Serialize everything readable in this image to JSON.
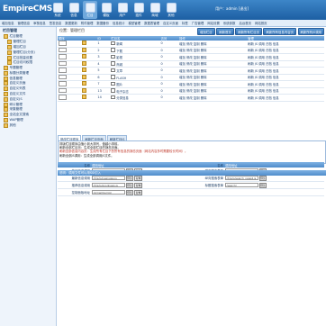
{
  "app": {
    "logo": "EmpireCMS"
  },
  "header": {
    "tabs": [
      {
        "label": "系统",
        "icon": "system-icon",
        "active": false
      },
      {
        "label": "信息",
        "icon": "info-icon",
        "active": false
      },
      {
        "label": "栏目",
        "icon": "column-icon",
        "active": true
      },
      {
        "label": "模板",
        "icon": "template-icon",
        "active": false
      },
      {
        "label": "用户",
        "icon": "user-icon",
        "active": false
      },
      {
        "label": "插件",
        "icon": "plugin-icon",
        "active": false
      },
      {
        "label": "商城",
        "icon": "shop-icon",
        "active": false
      },
      {
        "label": "其他",
        "icon": "other-icon",
        "active": false
      }
    ],
    "user_text": "用户：admin [退出]"
  },
  "menubar": [
    "增加信息",
    "管理信息",
    "审核信息",
    "签发信息",
    "数据更新",
    "附件管理",
    "数据备份",
    "信息统计",
    "模型管理",
    "数据表管理",
    "自定义页面",
    "标签",
    "广告管理",
    "网站设置",
    "系统参数",
    "后台首页",
    "网站首页"
  ],
  "sidebar": {
    "title": "栏目管理",
    "items": [
      {
        "label": "栏目管理",
        "sub": false
      },
      {
        "label": "管理栏目",
        "sub": true
      },
      {
        "label": "增加栏目",
        "sub": true
      },
      {
        "label": "管理栏目(分页)",
        "sub": true
      },
      {
        "label": "栏目批量设置",
        "sub": true
      },
      {
        "label": "栏目访问权限",
        "sub": true
      },
      {
        "label": "专题管理",
        "sub": false
      },
      {
        "label": "标题分类管理",
        "sub": false
      },
      {
        "label": "信息管理",
        "sub": false
      },
      {
        "label": "自定义页面",
        "sub": false
      },
      {
        "label": "自定义列表",
        "sub": false
      },
      {
        "label": "自定义文件",
        "sub": false
      },
      {
        "label": "自定义JS",
        "sub": false
      },
      {
        "label": "碎片管理",
        "sub": false
      },
      {
        "label": "采集管理",
        "sub": false
      },
      {
        "label": "全站全文搜索",
        "sub": false
      },
      {
        "label": "WAP管理",
        "sub": false
      },
      {
        "label": "其他",
        "sub": false
      }
    ]
  },
  "main": {
    "breadcrumb": "位置：管理栏目",
    "top_buttons": [
      "增加栏目",
      "刷新首页",
      "刷新所有栏目页",
      "刷新所有信息内容页",
      "刷新所有JS调用"
    ],
    "table": {
      "headers": [
        "顺序",
        "",
        "ID",
        "栏目名",
        "",
        "访问",
        "操作",
        "管理"
      ],
      "rows": [
        {
          "order": "1",
          "id": "1",
          "name": "新闻",
          "visits": "0",
          "ops": "增加 修改 复制 删除",
          "manage": "刷新 JS 调用 归档 信息"
        },
        {
          "order": "2",
          "id": "2",
          "name": "下载",
          "visits": "0",
          "ops": "增加 修改 复制 删除",
          "manage": "刷新 JS 调用 归档 信息"
        },
        {
          "order": "3",
          "id": "3",
          "name": "影视",
          "visits": "0",
          "ops": "增加 修改 复制 删除",
          "manage": "刷新 JS 调用 归档 信息"
        },
        {
          "order": "4",
          "id": "4",
          "name": "商城",
          "visits": "0",
          "ops": "增加 修改 复制 删除",
          "manage": "刷新 JS 调用 归档 信息"
        },
        {
          "order": "5",
          "id": "5",
          "name": "文章",
          "visits": "0",
          "ops": "增加 修改 复制 删除",
          "manage": "刷新 JS 调用 归档 信息"
        },
        {
          "order": "6",
          "id": "6",
          "name": "FLASH",
          "visits": "0",
          "ops": "增加 修改 复制 删除",
          "manage": "刷新 JS 调用 归档 信息"
        },
        {
          "order": "7",
          "id": "7",
          "name": "图片",
          "visits": "0",
          "ops": "增加 修改 复制 删除",
          "manage": "刷新 JS 调用 归档 信息"
        },
        {
          "order": "13",
          "id": "13",
          "name": "电子杂志",
          "visits": "0",
          "ops": "增加 修改 复制 删除",
          "manage": "刷新 JS 调用 归档 信息"
        },
        {
          "order": "14",
          "id": "14",
          "name": "分类信息",
          "visits": "0",
          "ops": "增加 修改 复制 删除",
          "manage": "刷新 JS 调用 归档 信息"
        }
      ]
    },
    "subtabs": [
      "修改栏目顺序",
      "刷新栏目页面",
      "刷新栏目JS"
    ],
    "notes": [
      "排版栏目顺序由值小到大排列，值越小排前。",
      "刷新全部栏目页：生成全部栏目的静态页面。",
      "刷新全部信息内容页：生成所有栏目下的所有信息的静态页面（网站内容多时需要较长时间）。",
      "刷新全部JS调用：生成全部调用JS文件。"
    ],
    "url_grid": {
      "headers": [
        "名称",
        "调用地址",
        "名称",
        "调用地址"
      ],
      "rows": [
        {
          "l_name": "热门信息调用",
          "l_url": "/d/js/js/hotnews.js",
          "r_name": "横向搜索表单",
          "r_url": "/d/js/js/search_news1.js"
        },
        {
          "l_name": "最新信息调用",
          "l_url": "/d/js/js/newnews.js",
          "r_name": "纵向搜索表单",
          "r_url": "/d/js/js/search_news2.js"
        },
        {
          "l_name": "推荐信息调用",
          "l_url": "/d/js/js/goodnews.js",
          "r_name": "标题搜索表单",
          "r_url": "/search/"
        },
        {
          "l_name": "控制面板地址",
          "l_url": "/e/member/cp/",
          "r_name": "",
          "r_url": ""
        }
      ],
      "preview_label": "预览",
      "copy_label": "复制"
    },
    "footer": "说明：调用文件可以用SSI引入"
  }
}
